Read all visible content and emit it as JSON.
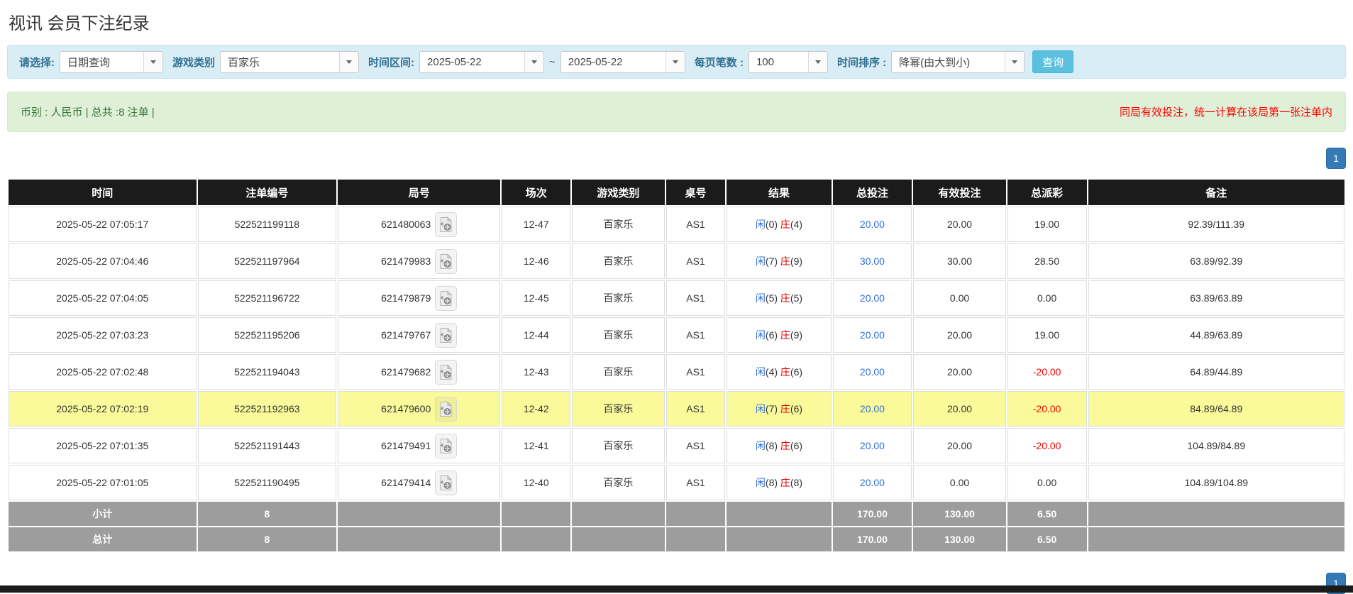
{
  "page": {
    "title": "视讯 会员下注纪录"
  },
  "colors": {
    "accent_blue": "#337ab7",
    "link_blue": "#2e6fd8",
    "banker_red": "#e60000",
    "negative_red": "#ff0000",
    "highlight_yellow": "#fafa9b",
    "table_header_bg": "#1b1b1b",
    "summary_row_gray": "#9d9d9d",
    "filter_panel_blue": "#d9edf7",
    "info_bar_green": "#dff0d8",
    "search_button_cyan": "#5bc0de"
  },
  "icons": {
    "dropdown": "chevron-down-icon",
    "video": "film-file-icon"
  },
  "filters": {
    "query_type_label": "请选择:",
    "query_type_value": "日期查询",
    "game_category_label": "游戏类别",
    "game_category_value": "百家乐",
    "time_range_label": "时间区间:",
    "date_from": "2025-05-22",
    "tilde": "~",
    "date_to": "2025-05-22",
    "page_size_label": "每页笔数 :",
    "page_size_value": "100",
    "sort_label": "时间排序 :",
    "sort_value": "降幂(由大到小)",
    "search_button": "查询"
  },
  "summary_bar": {
    "left_text": "币别 : 人民币 | 总共 :8 注单 |",
    "right_text": "同局有效投注，统一计算在该局第一张注单内"
  },
  "pagination": {
    "page": "1"
  },
  "table": {
    "headers": [
      "时间",
      "注单编号",
      "局号",
      "场次",
      "游戏类别",
      "桌号",
      "结果",
      "总投注",
      "有效投注",
      "总派彩",
      "备注"
    ],
    "rows": [
      {
        "time": "2025-05-22 07:05:17",
        "bet_id": "522521199118",
        "round_id": "621480063",
        "session": "12-47",
        "game": "百家乐",
        "table_no": "AS1",
        "player": "闲",
        "player_score": "(0)",
        "banker": "庄",
        "banker_score": "(4)",
        "total_bet": "20.00",
        "valid_bet": "20.00",
        "payout": "19.00",
        "remark": "92.39/111.39",
        "highlight": false
      },
      {
        "time": "2025-05-22 07:04:46",
        "bet_id": "522521197964",
        "round_id": "621479983",
        "session": "12-46",
        "game": "百家乐",
        "table_no": "AS1",
        "player": "闲",
        "player_score": "(7)",
        "banker": "庄",
        "banker_score": "(9)",
        "total_bet": "30.00",
        "valid_bet": "30.00",
        "payout": "28.50",
        "remark": "63.89/92.39",
        "highlight": false
      },
      {
        "time": "2025-05-22 07:04:05",
        "bet_id": "522521196722",
        "round_id": "621479879",
        "session": "12-45",
        "game": "百家乐",
        "table_no": "AS1",
        "player": "闲",
        "player_score": "(5)",
        "banker": "庄",
        "banker_score": "(5)",
        "total_bet": "20.00",
        "valid_bet": "0.00",
        "payout": "0.00",
        "remark": "63.89/63.89",
        "highlight": false
      },
      {
        "time": "2025-05-22 07:03:23",
        "bet_id": "522521195206",
        "round_id": "621479767",
        "session": "12-44",
        "game": "百家乐",
        "table_no": "AS1",
        "player": "闲",
        "player_score": "(6)",
        "banker": "庄",
        "banker_score": "(9)",
        "total_bet": "20.00",
        "valid_bet": "20.00",
        "payout": "19.00",
        "remark": "44.89/63.89",
        "highlight": false
      },
      {
        "time": "2025-05-22 07:02:48",
        "bet_id": "522521194043",
        "round_id": "621479682",
        "session": "12-43",
        "game": "百家乐",
        "table_no": "AS1",
        "player": "闲",
        "player_score": "(4)",
        "banker": "庄",
        "banker_score": "(6)",
        "total_bet": "20.00",
        "valid_bet": "20.00",
        "payout": "-20.00",
        "remark": "64.89/44.89",
        "highlight": false
      },
      {
        "time": "2025-05-22 07:02:19",
        "bet_id": "522521192963",
        "round_id": "621479600",
        "session": "12-42",
        "game": "百家乐",
        "table_no": "AS1",
        "player": "闲",
        "player_score": "(7)",
        "banker": "庄",
        "banker_score": "(6)",
        "total_bet": "20.00",
        "valid_bet": "20.00",
        "payout": "-20.00",
        "remark": "84.89/64.89",
        "highlight": true
      },
      {
        "time": "2025-05-22 07:01:35",
        "bet_id": "522521191443",
        "round_id": "621479491",
        "session": "12-41",
        "game": "百家乐",
        "table_no": "AS1",
        "player": "闲",
        "player_score": "(8)",
        "banker": "庄",
        "banker_score": "(6)",
        "total_bet": "20.00",
        "valid_bet": "20.00",
        "payout": "-20.00",
        "remark": "104.89/84.89",
        "highlight": false
      },
      {
        "time": "2025-05-22 07:01:05",
        "bet_id": "522521190495",
        "round_id": "621479414",
        "session": "12-40",
        "game": "百家乐",
        "table_no": "AS1",
        "player": "闲",
        "player_score": "(8)",
        "banker": "庄",
        "banker_score": "(8)",
        "total_bet": "20.00",
        "valid_bet": "0.00",
        "payout": "0.00",
        "remark": "104.89/104.89",
        "highlight": false
      }
    ],
    "subtotal": {
      "label": "小计",
      "count": "8",
      "total_bet": "170.00",
      "valid_bet": "130.00",
      "payout": "6.50"
    },
    "total": {
      "label": "总计",
      "count": "8",
      "total_bet": "170.00",
      "valid_bet": "130.00",
      "payout": "6.50"
    }
  }
}
